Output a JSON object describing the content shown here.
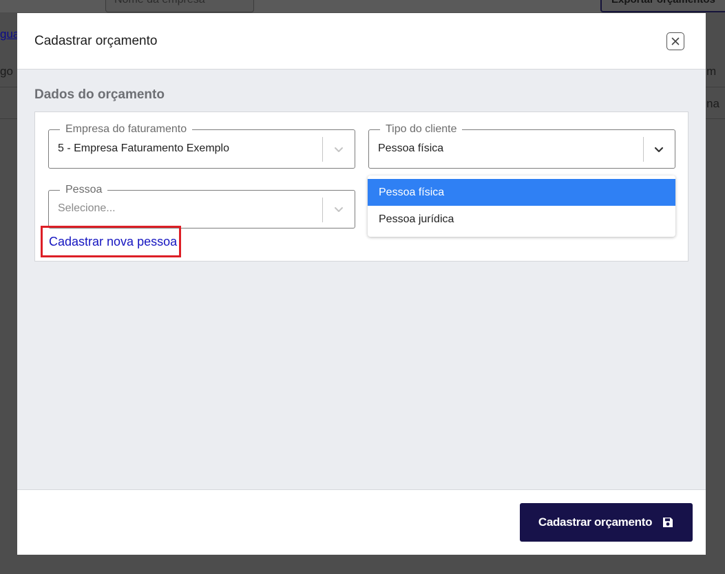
{
  "background": {
    "company_select": "Nome da empresa",
    "export_button": "Exportar orçamentos",
    "left_link": "gua",
    "left_text": "go",
    "right_text_1": "m",
    "right_text_2": "na"
  },
  "modal": {
    "title": "Cadastrar orçamento",
    "close_icon": "close-icon",
    "section_title": "Dados do orçamento",
    "fields": {
      "billing_company": {
        "label": "Empresa do faturamento",
        "value": "5 - Empresa Faturamento Exemplo"
      },
      "client_type": {
        "label": "Tipo do cliente",
        "value": "Pessoa física"
      },
      "person": {
        "label": "Pessoa",
        "placeholder": "Selecione..."
      }
    },
    "new_person_link": "Cadastrar nova pessoa",
    "client_type_options": [
      "Pessoa física",
      "Pessoa jurídica"
    ],
    "submit_button": "Cadastrar orçamento",
    "submit_icon": "save-icon"
  },
  "colors": {
    "primary_button": "#17124a",
    "option_highlight": "#2f80f4",
    "link": "#1515c0",
    "highlight_box": "#dd1f26"
  }
}
